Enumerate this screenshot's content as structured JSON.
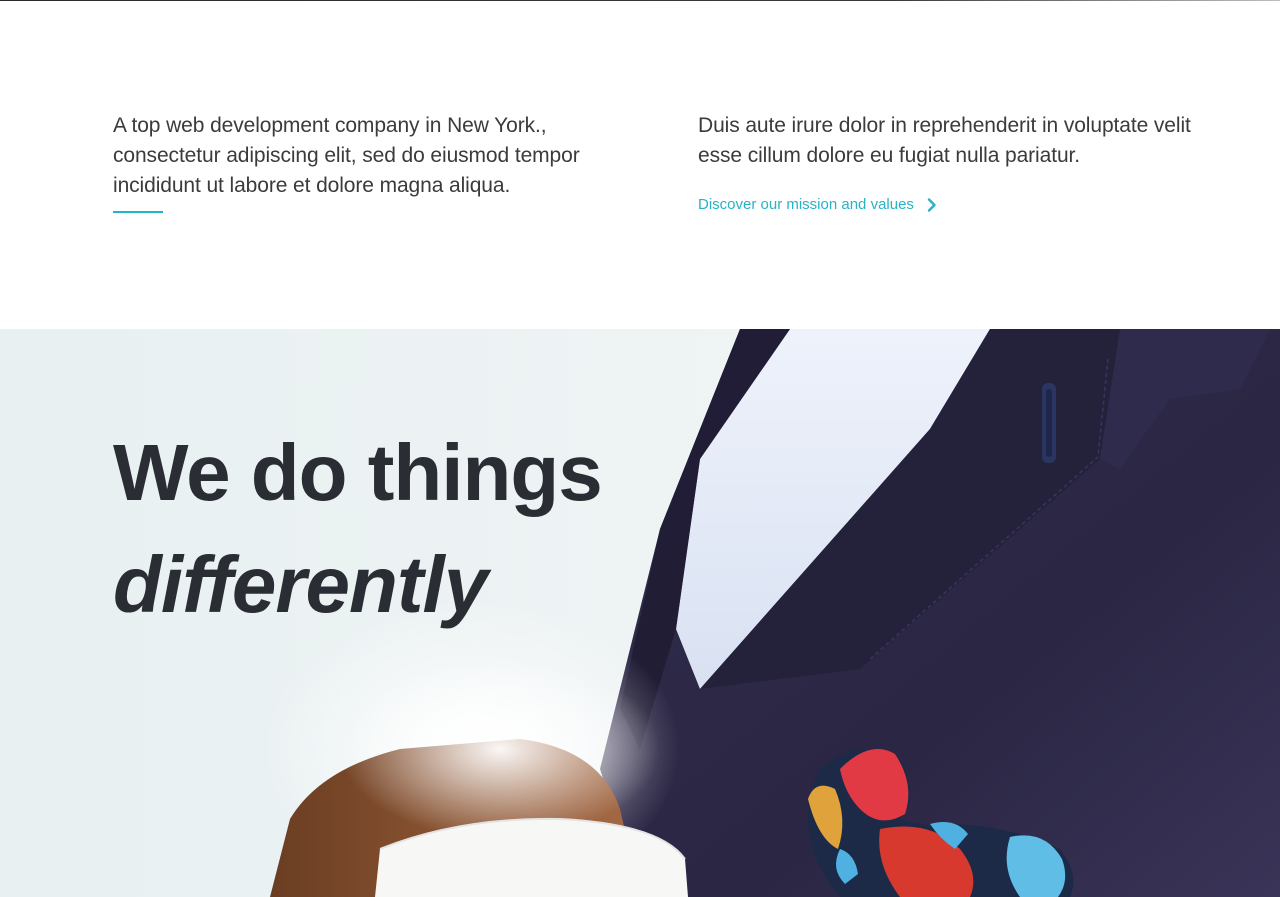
{
  "intro": {
    "left_text": "A top web development company in New York., consectetur adipiscing elit, sed do eiusmod tempor incididunt ut labore et dolore magna aliqua.",
    "right_text": "Duis aute irure dolor in reprehenderit in voluptate velit esse cillum dolore eu fugiat nulla pariatur.",
    "link_label": "Discover our mission and values",
    "link_icon": "chevron-right-icon"
  },
  "hero": {
    "title_line1": "We do things",
    "title_line2": "differently",
    "image_subject": "person in navy suit holding a coffee cup"
  },
  "colors": {
    "accent": "#22b7c8",
    "text": "#3b3b3b",
    "heading": "#2a2d33",
    "suit": "#2b2744"
  }
}
